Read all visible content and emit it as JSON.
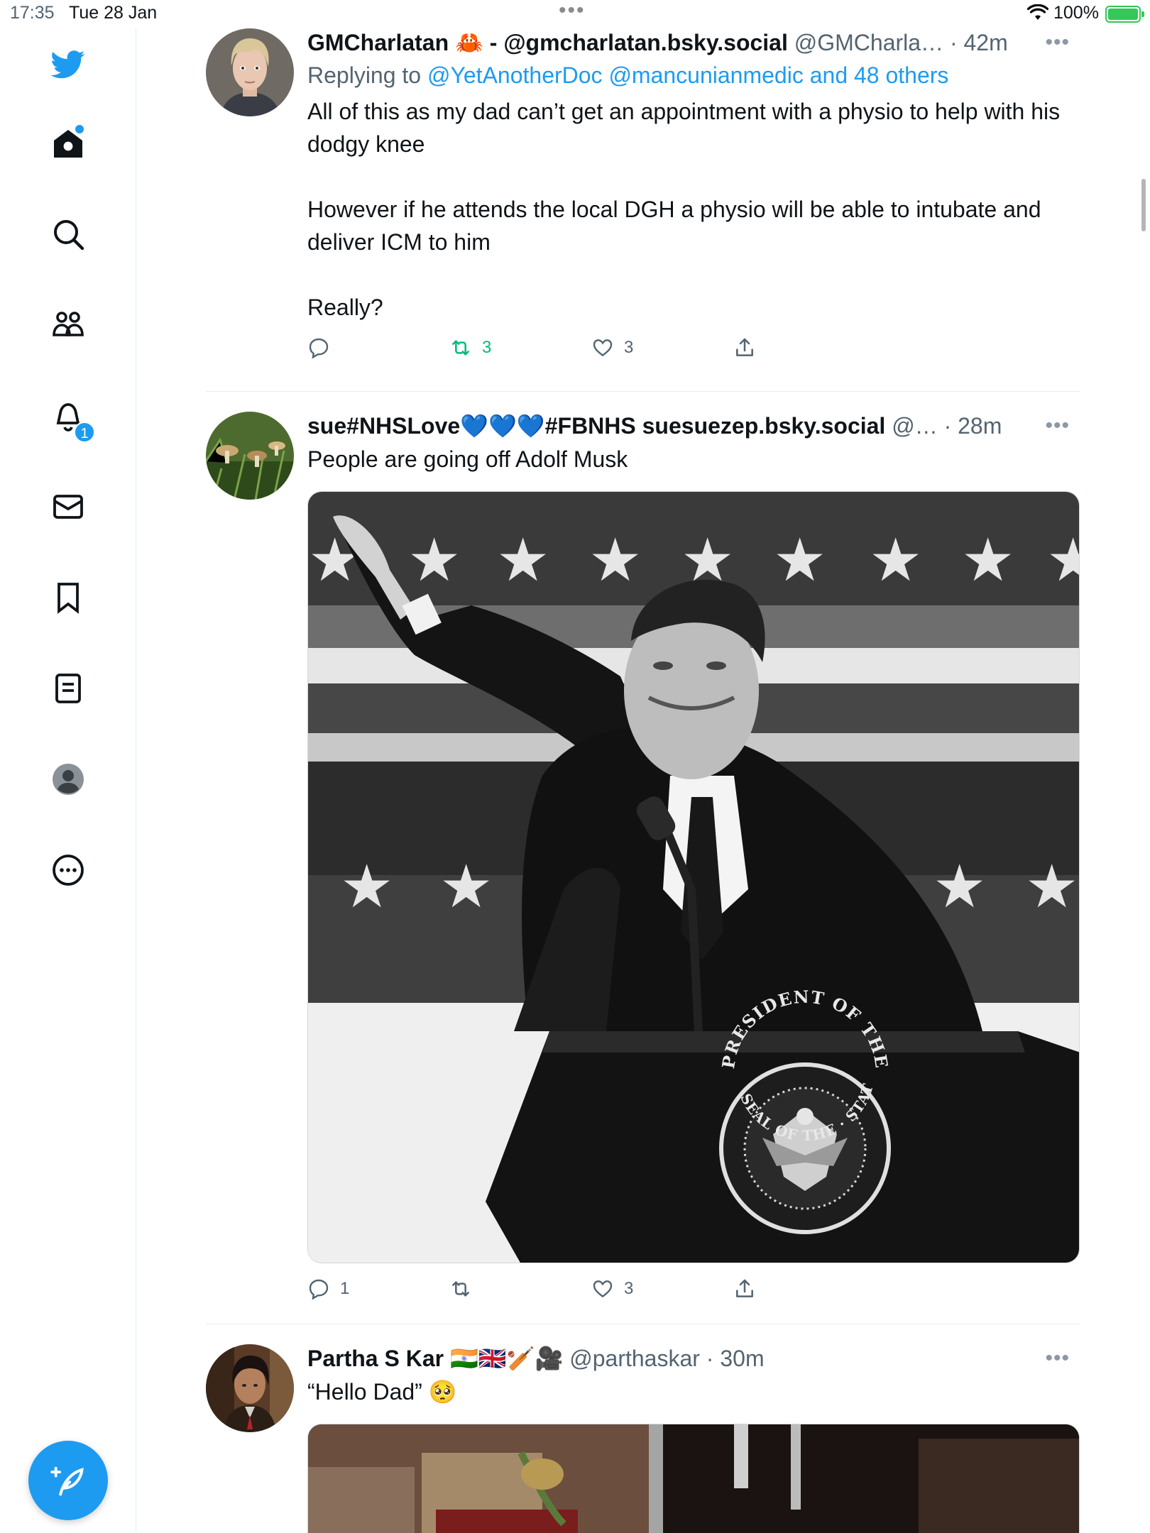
{
  "status_bar": {
    "time": "17:35",
    "date": "Tue 28 Jan",
    "battery": "100%"
  },
  "colors": {
    "accent": "#1d9bf0",
    "retweet_active": "#00ba7c",
    "muted": "#536471"
  },
  "sidebar": {
    "items": [
      {
        "icon": "twitter-logo-icon"
      },
      {
        "icon": "home-icon"
      },
      {
        "icon": "search-icon"
      },
      {
        "icon": "communities-icon"
      },
      {
        "icon": "notifications-bell-icon",
        "badge": "1"
      },
      {
        "icon": "messages-envelope-icon"
      },
      {
        "icon": "bookmark-icon"
      },
      {
        "icon": "lists-icon"
      },
      {
        "icon": "profile-icon"
      },
      {
        "icon": "more-options-icon"
      }
    ],
    "compose_icon": "compose-feather-icon"
  },
  "tweets": [
    {
      "name": "GMCharlatan 🦀 - @gmcharlatan.bsky.social",
      "handle": "@GMCharla…",
      "time": "42m",
      "reply_prefix": "Replying to",
      "reply_mentions": "@YetAnotherDoc @mancunianmedic and 48 others",
      "text": "All of this as my dad can’t get an appointment with a physio to help with his dodgy knee\n\nHowever if he attends the local DGH a physio will be able to intubate and deliver ICM to him\n\nReally?",
      "replies": "",
      "retweets": "3",
      "likes": "3"
    },
    {
      "name": "sue#NHSLove💙💙💙#FBNHS suesuezep.bsky.social",
      "handle": "@…",
      "time": "28m",
      "text": "People are going off Adolf Musk",
      "replies": "1",
      "retweets": "",
      "likes": "3",
      "media": {
        "seal_top": "PRESIDENT OF THE UNITED",
        "seal_bottom": "SEAL OF THE · STATES ·"
      }
    },
    {
      "name": "Partha S Kar 🇮🇳🇬🇧🏏🎥",
      "handle": "@parthaskar",
      "time": "30m",
      "text": "“Hello Dad” 🥺"
    }
  ]
}
